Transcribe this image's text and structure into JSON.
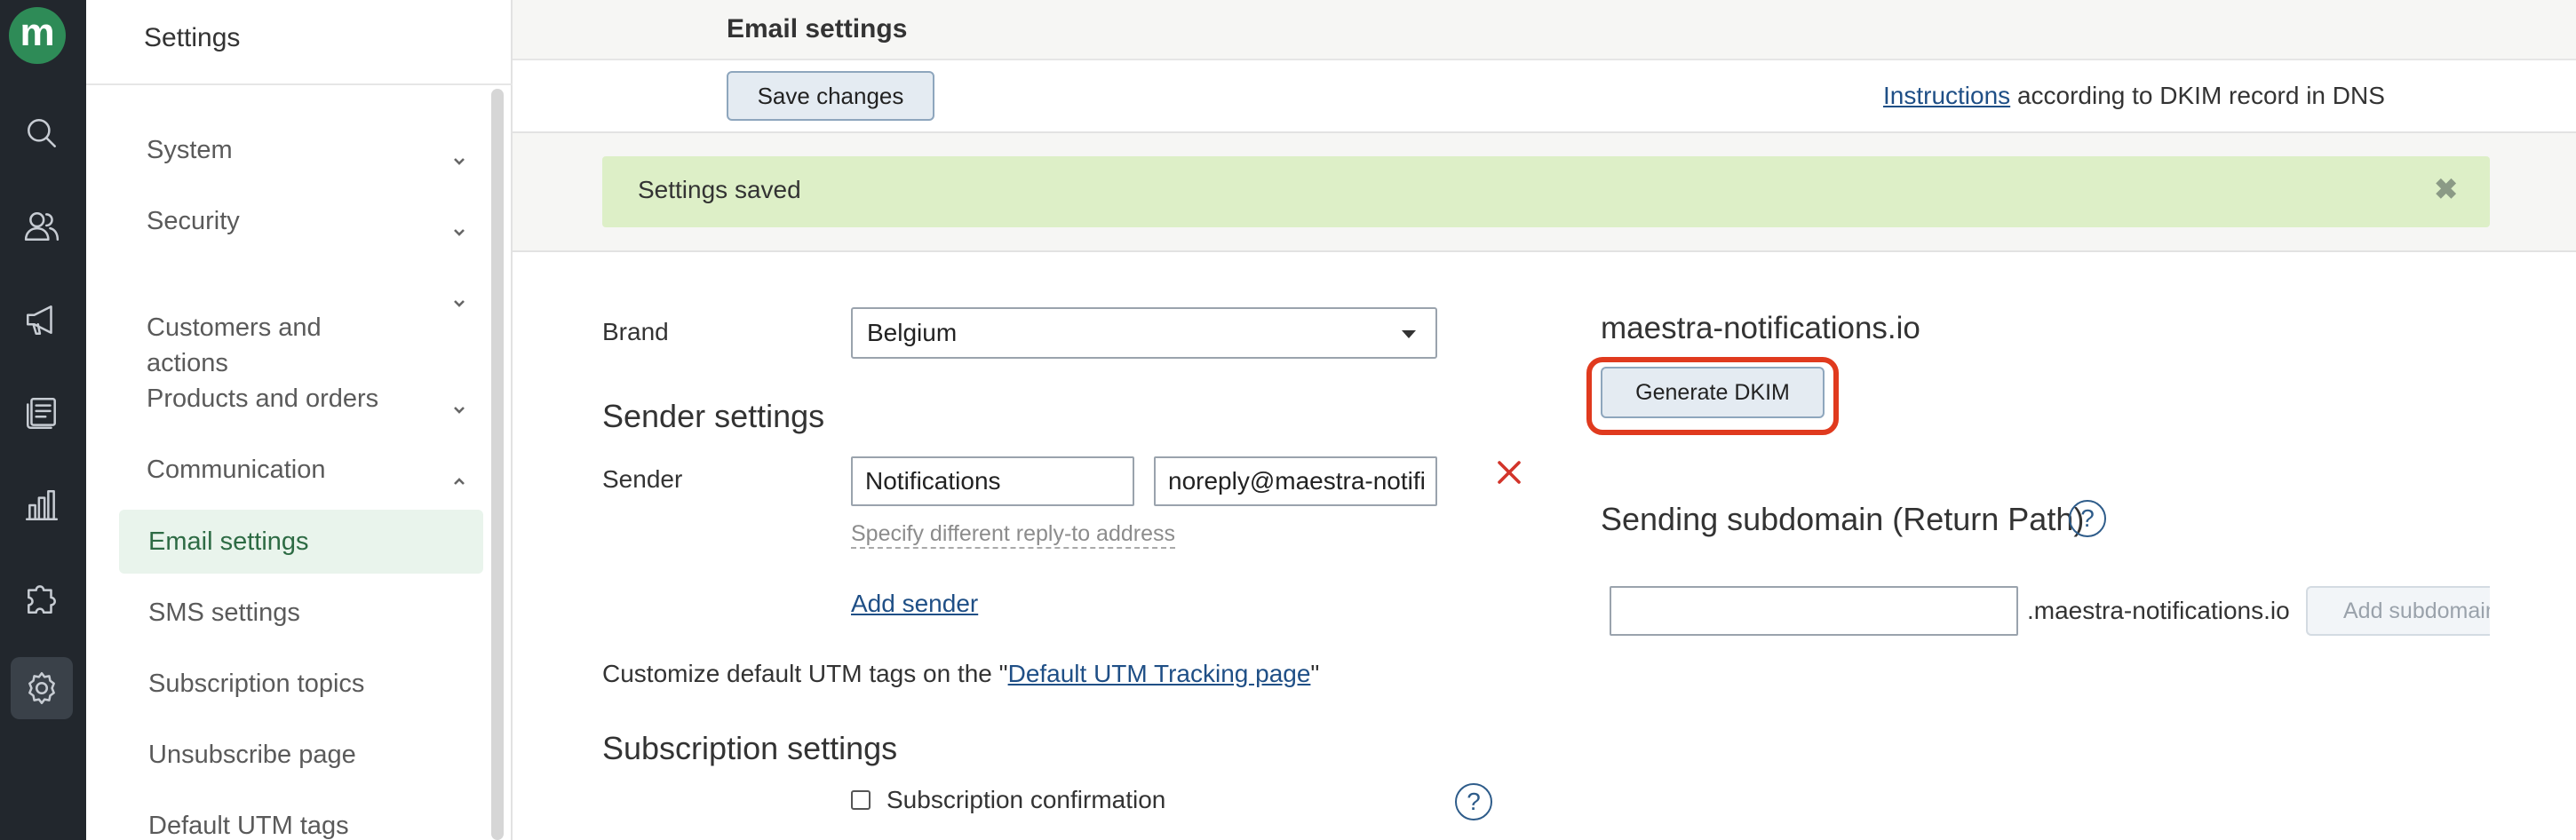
{
  "app": {
    "logo_letter": "m",
    "brand_color": "#2e8b57"
  },
  "rail": {
    "icons": [
      "search-icon",
      "users-icon",
      "megaphone-icon",
      "newsletter-icon",
      "bar-chart-icon",
      "puzzle-icon",
      "gear-icon"
    ],
    "active": "gear-icon"
  },
  "sidebar": {
    "title": "Settings",
    "groups": [
      {
        "label": "System",
        "expanded": false
      },
      {
        "label": "Security",
        "expanded": false
      },
      {
        "label": "Customers and\nactions",
        "expanded": false
      },
      {
        "label": "Products and orders",
        "expanded": false
      },
      {
        "label": "Communication",
        "expanded": true
      }
    ],
    "items": [
      {
        "label": "Email settings",
        "active": true
      },
      {
        "label": "SMS settings"
      },
      {
        "label": "Subscription topics"
      },
      {
        "label": "Unsubscribe page"
      },
      {
        "label": "Default UTM tags"
      }
    ]
  },
  "header": {
    "title": "Email settings",
    "save_label": "Save changes",
    "instructions_link": "Instructions",
    "instructions_rest": " according to DKIM record in DNS"
  },
  "alert": {
    "text": "Settings saved",
    "close_glyph": "✖",
    "color": "#ddefc7"
  },
  "form": {
    "brand_label": "Brand",
    "brand_value": "Belgium",
    "sender_settings_heading": "Sender settings",
    "sender_label": "Sender",
    "sender_name": "Notifications",
    "sender_email": "noreply@maestra-notifi",
    "reply_to_link": "Specify different reply-to address",
    "add_sender": "Add sender",
    "utm_prefix": "Customize default UTM tags on the \"",
    "utm_link": "Default UTM Tracking page",
    "utm_suffix": "\"",
    "subscription_heading": "Subscription settings",
    "subscription_confirmation": "Subscription confirmation",
    "help_glyph": "?"
  },
  "dkim": {
    "domain": "maestra-notifications.io",
    "generate_label": "Generate DKIM",
    "highlight_color": "#e03a1e",
    "return_path_heading": "Sending subdomain (Return Path)",
    "subdomain_value": "",
    "subdomain_suffix": ".maestra-notifications.io",
    "add_subdomain_label": "Add subdomain"
  }
}
